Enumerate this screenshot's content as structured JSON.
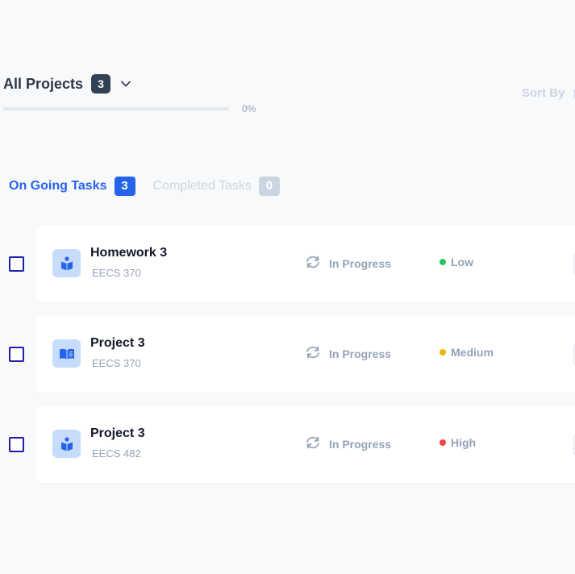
{
  "header": {
    "title": "All Projects",
    "count": "3",
    "progress_fraction": 0,
    "progress_text": "0%",
    "sort_label": "Sort By"
  },
  "tabs": [
    {
      "label": "On Going Tasks",
      "count": "3",
      "active": true
    },
    {
      "label": "Completed Tasks",
      "count": "0",
      "active": false
    }
  ],
  "tasks": [
    {
      "title": "Homework 3",
      "course": "EECS 370",
      "status": "In Progress",
      "priority": "Low",
      "priority_color": "#22c55e",
      "icon": "book-reader-icon"
    },
    {
      "title": "Project 3",
      "course": "EECS 370",
      "status": "In Progress",
      "priority": "Medium",
      "priority_color": "#eab308",
      "icon": "open-book-icon"
    },
    {
      "title": "Project 3",
      "course": "EECS 482",
      "status": "In Progress",
      "priority": "High",
      "priority_color": "#ef4444",
      "icon": "book-reader-icon"
    }
  ],
  "colors": {
    "accent": "#2563eb",
    "icon_bg": "#c7dcfb",
    "icon_fg": "#2563eb",
    "checkbox_border": "#1e1ea8"
  }
}
